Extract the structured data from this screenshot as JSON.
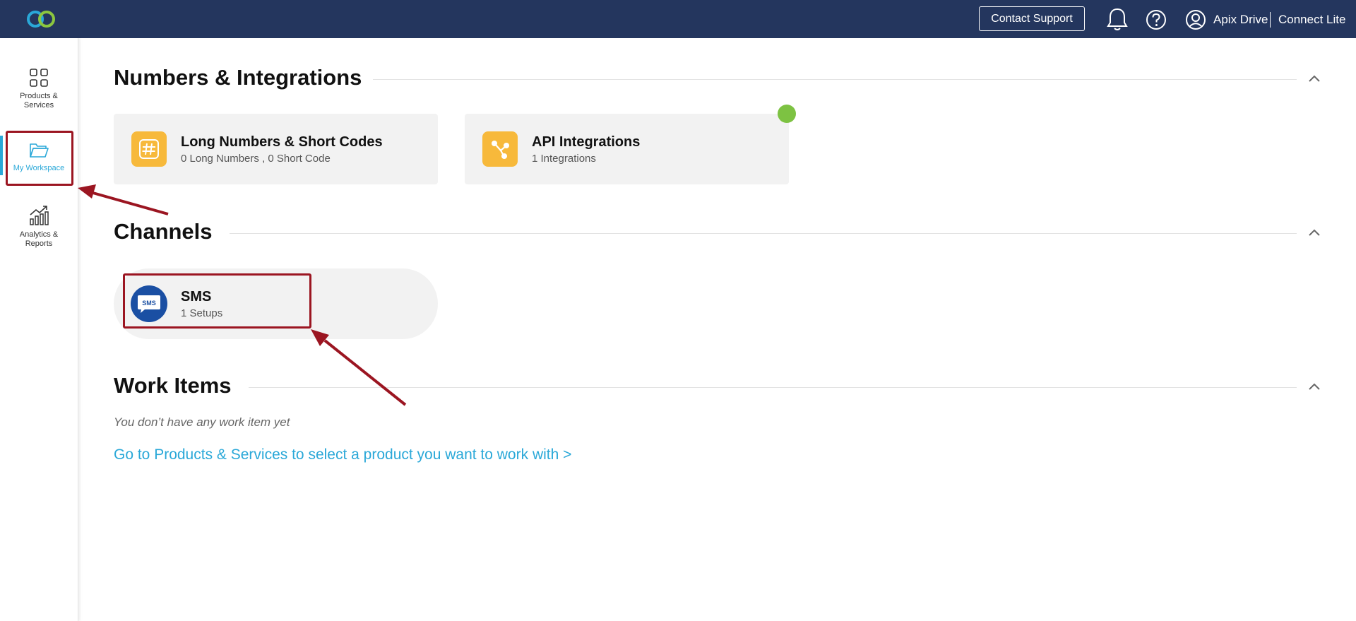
{
  "header": {
    "contact_support_label": "Contact Support",
    "user_name": "Apix Drive",
    "product_name": "Connect Lite"
  },
  "sidebar": {
    "items": [
      {
        "label_line1": "Products &",
        "label_line2": "Services",
        "icon": "grid-icon"
      },
      {
        "label_line1": "My Workspace",
        "label_line2": "",
        "icon": "folder-icon",
        "active": true
      },
      {
        "label_line1": "Analytics &",
        "label_line2": "Reports",
        "icon": "bar-chart-icon"
      }
    ]
  },
  "sections": {
    "numbers": {
      "title": "Numbers & Integrations",
      "cards": [
        {
          "title": "Long Numbers & Short Codes",
          "subtitle": "0 Long Numbers ,  0 Short Code",
          "icon": "hash-icon"
        },
        {
          "title": "API Integrations",
          "subtitle": "1 Integrations",
          "icon": "share-icon"
        }
      ]
    },
    "channels": {
      "title": "Channels",
      "cards": [
        {
          "title": "SMS",
          "subtitle": "1 Setups",
          "icon": "sms-icon",
          "icon_text": "SMS"
        }
      ]
    },
    "work_items": {
      "title": "Work Items",
      "empty_text": "You don’t have any work item yet",
      "link_text": "Go to Products & Services to select a product you want to work with >"
    }
  },
  "colors": {
    "topbar": "#24365e",
    "accent": "#2aa8d8",
    "card_icon": "#f7b93b",
    "status_dot": "#7dc242",
    "highlight": "#9b1521"
  }
}
